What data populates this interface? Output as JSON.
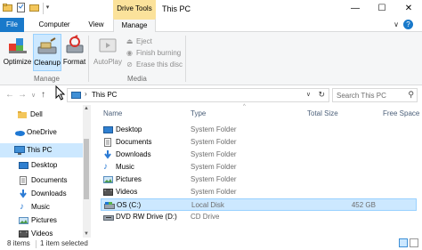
{
  "titlebar": {
    "contextual_tab": "Drive Tools",
    "title": "This PC",
    "minimize": "—",
    "maximize": "☐",
    "close": "✕"
  },
  "tabs": {
    "file": "File",
    "computer": "Computer",
    "view": "View",
    "manage": "Manage",
    "help": "?"
  },
  "ribbon": {
    "optimize": "Optimize",
    "cleanup": "Cleanup",
    "format": "Format",
    "autoplay": "AutoPlay",
    "eject": "Eject",
    "finish_burning": "Finish burning",
    "erase_disc": "Erase this disc",
    "group_manage": "Manage",
    "group_media": "Media"
  },
  "address": {
    "crumb": "This PC",
    "search_placeholder": "Search This PC"
  },
  "nav": {
    "items": [
      {
        "label": "Dell"
      },
      {
        "label": "OneDrive"
      },
      {
        "label": "This PC"
      },
      {
        "label": "Desktop"
      },
      {
        "label": "Documents"
      },
      {
        "label": "Downloads"
      },
      {
        "label": "Music"
      },
      {
        "label": "Pictures"
      },
      {
        "label": "Videos"
      }
    ]
  },
  "columns": {
    "name": "Name",
    "type": "Type",
    "total_size": "Total Size",
    "free_space": "Free Space"
  },
  "files": [
    {
      "name": "Desktop",
      "type": "System Folder",
      "size": ""
    },
    {
      "name": "Documents",
      "type": "System Folder",
      "size": ""
    },
    {
      "name": "Downloads",
      "type": "System Folder",
      "size": ""
    },
    {
      "name": "Music",
      "type": "System Folder",
      "size": ""
    },
    {
      "name": "Pictures",
      "type": "System Folder",
      "size": ""
    },
    {
      "name": "Videos",
      "type": "System Folder",
      "size": ""
    },
    {
      "name": "OS (C:)",
      "type": "Local Disk",
      "size": "452 GB"
    },
    {
      "name": "DVD RW Drive (D:)",
      "type": "CD Drive",
      "size": ""
    }
  ],
  "status": {
    "count": "8 items",
    "selected": "1 item selected"
  },
  "colors": {
    "accent": "#1979ca",
    "selection": "#cce8ff",
    "contextual": "#fbe29b"
  }
}
